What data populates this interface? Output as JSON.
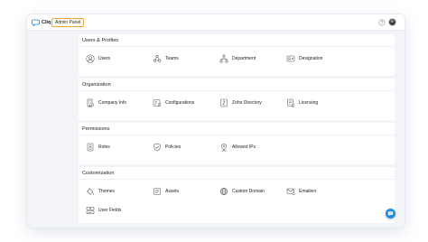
{
  "header": {
    "brand_name": "Cliq",
    "panel_label": "Admin Panel"
  },
  "sections": [
    {
      "title": "Users & Profiles",
      "items": [
        {
          "label": "Users",
          "icon": "user-icon"
        },
        {
          "label": "Teams",
          "icon": "teams-icon"
        },
        {
          "label": "Department",
          "icon": "department-icon"
        },
        {
          "label": "Designation",
          "icon": "designation-icon"
        }
      ]
    },
    {
      "title": "Organization",
      "items": [
        {
          "label": "Company Info",
          "icon": "company-icon"
        },
        {
          "label": "Configurations",
          "icon": "configurations-icon"
        },
        {
          "label": "Zoho Directory",
          "icon": "directory-icon"
        },
        {
          "label": "Licensing",
          "icon": "licensing-icon"
        }
      ]
    },
    {
      "title": "Permissions",
      "items": [
        {
          "label": "Roles",
          "icon": "roles-icon"
        },
        {
          "label": "Policies",
          "icon": "policies-icon"
        },
        {
          "label": "Allowed IPs",
          "icon": "allowed-ips-icon"
        }
      ]
    },
    {
      "title": "Customization",
      "items": [
        {
          "label": "Themes",
          "icon": "themes-icon"
        },
        {
          "label": "Assets",
          "icon": "assets-icon"
        },
        {
          "label": "Custom Domain",
          "icon": "globe-icon"
        },
        {
          "label": "Emailers",
          "icon": "emailers-icon"
        },
        {
          "label": "User Fields",
          "icon": "user-fields-icon"
        }
      ]
    }
  ],
  "colors": {
    "accent": "#f0a637",
    "chat_button": "#1a8fe3",
    "brand_logo": "#1a8fe3"
  }
}
